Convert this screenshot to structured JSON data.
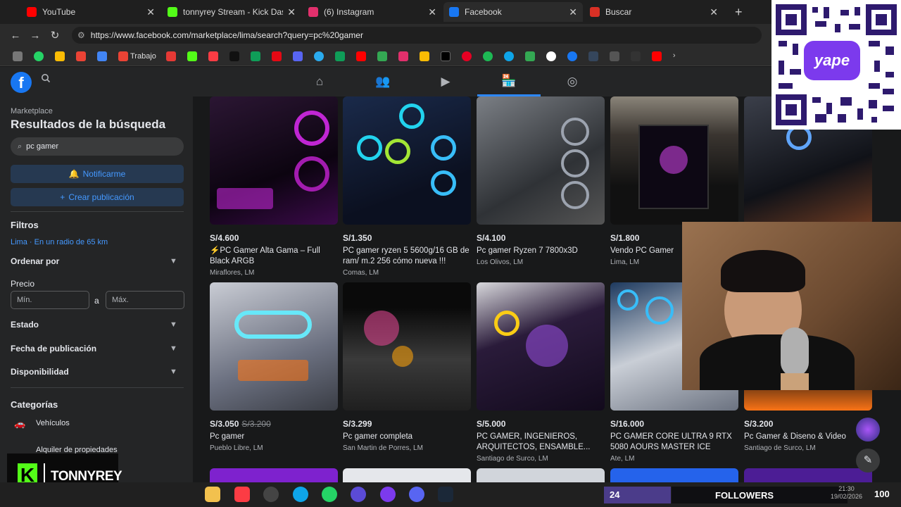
{
  "browser": {
    "tabs": [
      {
        "title": "YouTube",
        "color": "#ff0000"
      },
      {
        "title": "tonnyrey Stream - Kick Dashboard",
        "color": "#53fc18"
      },
      {
        "title": "(6) Instagram",
        "color": "#e1306c"
      },
      {
        "title": "Facebook",
        "color": "#1877f2",
        "active": true
      },
      {
        "title": "Buscar",
        "color": "#d93025"
      }
    ],
    "url": "https://www.facebook.com/marketplace/lima/search?query=pc%20gamer",
    "bookmark_label": "Trabajo"
  },
  "sidebar": {
    "small": "Marketplace",
    "title": "Resultados de la búsqueda",
    "search_value": "pc gamer",
    "notify_label": "Notificarme",
    "create_label": "Crear publicación",
    "filters_title": "Filtros",
    "location": "Lima · En un radio de 65 km",
    "sort_label": "Ordenar por",
    "price_label": "Precio",
    "min_placeholder": "Mín.",
    "max_placeholder": "Máx.",
    "price_sep": "a",
    "state_label": "Estado",
    "date_label": "Fecha de publicación",
    "avail_label": "Disponibilidad",
    "categories_title": "Categorías",
    "cat_vehicles": "Vehículos",
    "cat_rent": "Alquiler de propiedades"
  },
  "listings": [
    {
      "price": "S/4.600",
      "title": "⚡PC Gamer Alta Gama – Full Black ARGB",
      "location": "Miraflores, LM",
      "accent": "#c026d3"
    },
    {
      "price": "S/1.350",
      "title": "PC gamer ryzen 5 5600g/16 GB de ram/ m.2 256 cómo nueva !!!",
      "location": "Comas, LM",
      "accent": "#22d3ee"
    },
    {
      "price": "S/4.100",
      "title": "Pc gamer Ryzen 7 7800x3D",
      "location": "Los Olivos, LM",
      "accent": "#9ca3af"
    },
    {
      "price": "S/1.800",
      "title": "Vendo PC Gamer",
      "location": "Lima, LM",
      "accent": "#d946ef"
    },
    {
      "price": "",
      "title": "",
      "location": "",
      "accent": "#60a5fa"
    },
    {
      "price": "S/3.050",
      "old_price": "S/3.200",
      "title": "Pc gamer",
      "location": "Pueblo Libre, LM",
      "accent": "#67e8f9"
    },
    {
      "price": "S/3.299",
      "title": "Pc gamer completa",
      "location": "San Martin de Porres, LM",
      "accent": "#ec4899"
    },
    {
      "price": "S/5.000",
      "title": "PC GAMER, INGENIEROS, ARQUITECTOS, ENSAMBLE...",
      "location": "Santiago de Surco, LM",
      "accent": "#a855f7"
    },
    {
      "price": "S/16.000",
      "title": "PC GAMER CORE ULTRA 9 RTX 5080 AOURS MASTER ICE",
      "location": "Ate, LM",
      "accent": "#38bdf8"
    },
    {
      "price": "S/3.200",
      "title": "Pc Gamer & Diseno & Video",
      "location": "Santiago de Surco, LM",
      "accent": "#f97316"
    }
  ],
  "overlay": {
    "followers_count": "24",
    "followers_label": "FOLLOWERS",
    "followers_right": "100",
    "kick_name": "TONNYREY",
    "kick_letter": "K",
    "time": "21:30",
    "date": "19/02/2026",
    "yape_label": "yape"
  }
}
